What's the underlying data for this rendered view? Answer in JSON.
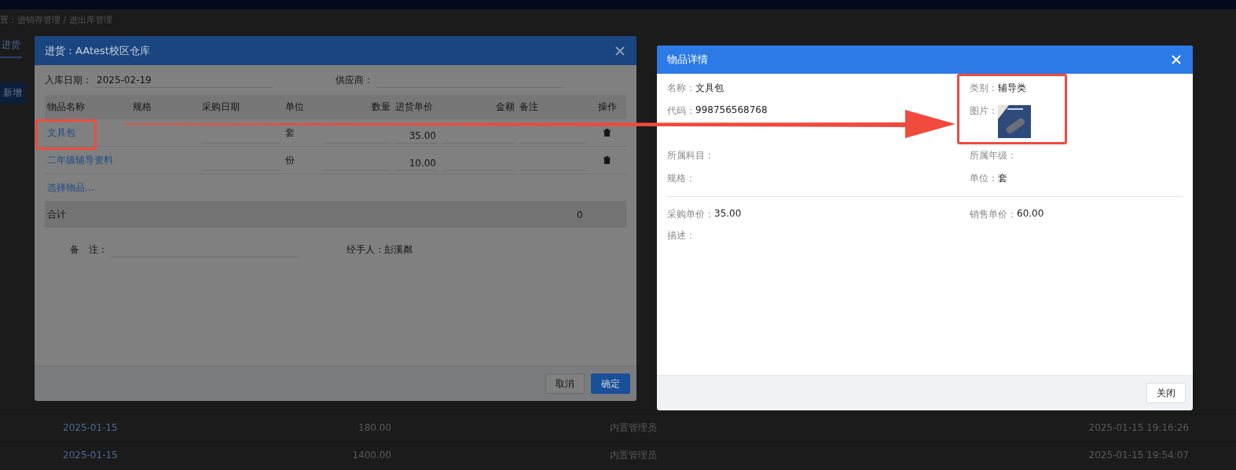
{
  "page": {
    "breadcrumb": "置：进销存管理 / 进出库管理",
    "tab": "进货",
    "add_button": "新增",
    "rows": [
      {
        "date": "2025-01-15",
        "amount": "180.00",
        "operator": "内置管理员",
        "time": "2025-01-15 19:16:26"
      },
      {
        "date": "2025-01-15",
        "amount": "1400.00",
        "operator": "内置管理员",
        "time": "2025-01-15 19:54:07"
      }
    ]
  },
  "purchase_dialog": {
    "title": "进货：AAtest校区仓库",
    "date_label": "入库日期：",
    "date_value": "2025-02-19",
    "supplier_label": "供应商：",
    "columns": [
      "物品名称",
      "规格",
      "采购日期",
      "单位",
      "数量",
      "进货单价",
      "金额",
      "备注",
      "操作"
    ],
    "items": [
      {
        "name": "文具包",
        "unit": "套",
        "price": "35.00"
      },
      {
        "name": "二年级辅导资料",
        "unit": "份",
        "price": "10.00"
      }
    ],
    "select_link": "选择物品...",
    "total_label": "合计",
    "total_value": "0",
    "remark_label": "备　注：",
    "handler_label": "经手人：",
    "handler_value": "彭溪粼",
    "buttons": [
      {
        "label": "取消",
        "kind": "default"
      },
      {
        "label": "确定",
        "kind": "primary"
      }
    ]
  },
  "detail_dialog": {
    "title": "物品详情",
    "fields": [
      {
        "label": "名称：",
        "value": "文具包",
        "kind": "text"
      },
      {
        "label": "类别：",
        "value": "辅导类",
        "kind": "text"
      },
      {
        "label": "代码：",
        "value": "998756568768",
        "kind": "text"
      },
      {
        "label": "图片：",
        "kind": "image"
      },
      {
        "label": "所属科目：",
        "kind": "text"
      },
      {
        "label": "所属年级：",
        "kind": "text"
      },
      {
        "label": "规格：",
        "kind": "text"
      },
      {
        "label": "单位：",
        "value": "套",
        "kind": "text"
      }
    ],
    "prices": [
      {
        "label": "采购单价：",
        "value": "35.00"
      },
      {
        "label": "销售单价：",
        "value": "60.00"
      },
      {
        "label": "描述："
      }
    ],
    "buttons": [
      "关闭"
    ]
  }
}
